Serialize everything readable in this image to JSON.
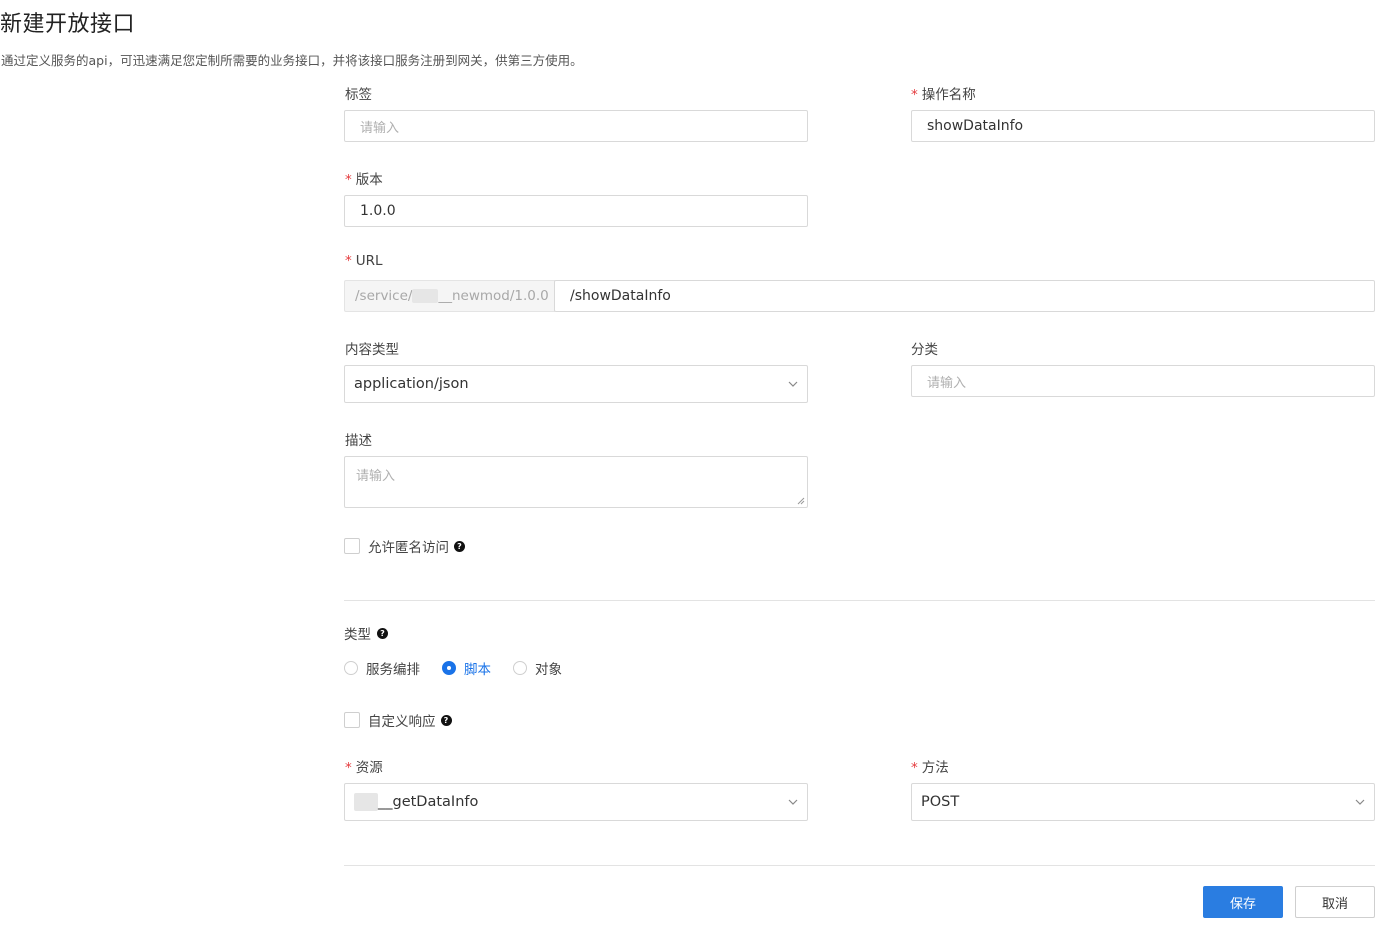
{
  "page": {
    "title": "新建开放接口",
    "subtitle": "通过定义服务的api，可迅速满足您定制所需要的业务接口，并将该接口服务注册到网关，供第三方使用。"
  },
  "form": {
    "tag": {
      "label": "标签",
      "placeholder": "请输入",
      "value": ""
    },
    "operation_name": {
      "label": "操作名称",
      "required": true,
      "value": "showDataInfo"
    },
    "version": {
      "label": "版本",
      "required": true,
      "value": "1.0.0"
    },
    "url": {
      "label": "URL",
      "required": true,
      "prefix_start": "/service/",
      "prefix_end": "__newmod/1.0.0",
      "value": "/showDataInfo"
    },
    "content_type": {
      "label": "内容类型",
      "value": "application/json"
    },
    "category": {
      "label": "分类",
      "placeholder": "请输入",
      "value": ""
    },
    "description": {
      "label": "描述",
      "placeholder": "请输入",
      "value": ""
    },
    "anonymous_access": {
      "label": "允许匿名访问",
      "checked": false
    },
    "type": {
      "label": "类型",
      "options": [
        "服务编排",
        "脚本",
        "对象"
      ],
      "selected": "脚本"
    },
    "custom_response": {
      "label": "自定义响应",
      "checked": false
    },
    "resource": {
      "label": "资源",
      "required": true,
      "value_suffix": "__getDataInfo"
    },
    "method": {
      "label": "方法",
      "required": true,
      "value": "POST"
    }
  },
  "actions": {
    "save": "保存",
    "cancel": "取消"
  },
  "colors": {
    "accent": "#2a7de1",
    "required": "#e4393c",
    "border": "#d9d9d9"
  },
  "icons": {
    "help": "question-circle-icon",
    "dropdown": "chevron-down-icon",
    "resize": "resize-handle-icon"
  }
}
